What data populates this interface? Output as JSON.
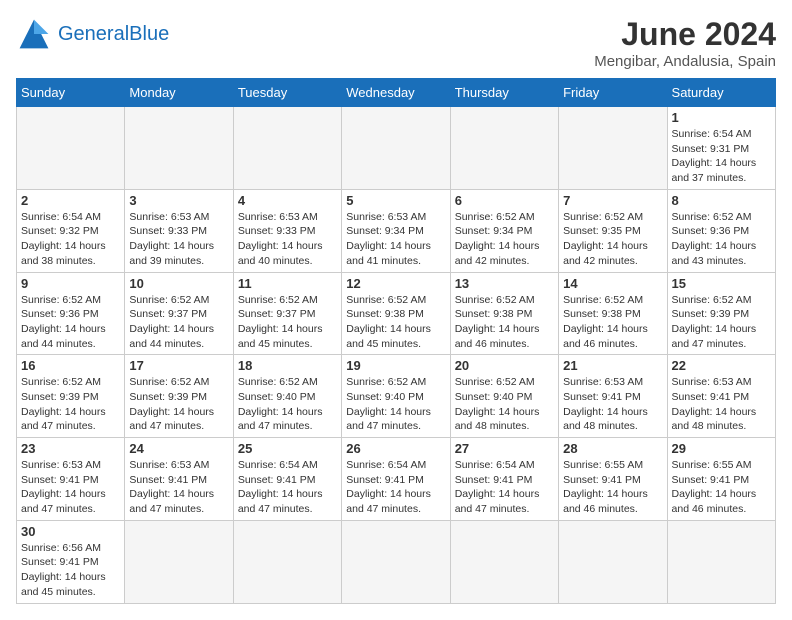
{
  "header": {
    "logo_general": "General",
    "logo_blue": "Blue",
    "month_title": "June 2024",
    "subtitle": "Mengibar, Andalusia, Spain"
  },
  "weekdays": [
    "Sunday",
    "Monday",
    "Tuesday",
    "Wednesday",
    "Thursday",
    "Friday",
    "Saturday"
  ],
  "days": {
    "d1": {
      "num": "1",
      "info": "Sunrise: 6:54 AM\nSunset: 9:31 PM\nDaylight: 14 hours\nand 37 minutes."
    },
    "d2": {
      "num": "2",
      "info": "Sunrise: 6:54 AM\nSunset: 9:32 PM\nDaylight: 14 hours\nand 38 minutes."
    },
    "d3": {
      "num": "3",
      "info": "Sunrise: 6:53 AM\nSunset: 9:33 PM\nDaylight: 14 hours\nand 39 minutes."
    },
    "d4": {
      "num": "4",
      "info": "Sunrise: 6:53 AM\nSunset: 9:33 PM\nDaylight: 14 hours\nand 40 minutes."
    },
    "d5": {
      "num": "5",
      "info": "Sunrise: 6:53 AM\nSunset: 9:34 PM\nDaylight: 14 hours\nand 41 minutes."
    },
    "d6": {
      "num": "6",
      "info": "Sunrise: 6:52 AM\nSunset: 9:34 PM\nDaylight: 14 hours\nand 42 minutes."
    },
    "d7": {
      "num": "7",
      "info": "Sunrise: 6:52 AM\nSunset: 9:35 PM\nDaylight: 14 hours\nand 42 minutes."
    },
    "d8": {
      "num": "8",
      "info": "Sunrise: 6:52 AM\nSunset: 9:36 PM\nDaylight: 14 hours\nand 43 minutes."
    },
    "d9": {
      "num": "9",
      "info": "Sunrise: 6:52 AM\nSunset: 9:36 PM\nDaylight: 14 hours\nand 44 minutes."
    },
    "d10": {
      "num": "10",
      "info": "Sunrise: 6:52 AM\nSunset: 9:37 PM\nDaylight: 14 hours\nand 44 minutes."
    },
    "d11": {
      "num": "11",
      "info": "Sunrise: 6:52 AM\nSunset: 9:37 PM\nDaylight: 14 hours\nand 45 minutes."
    },
    "d12": {
      "num": "12",
      "info": "Sunrise: 6:52 AM\nSunset: 9:38 PM\nDaylight: 14 hours\nand 45 minutes."
    },
    "d13": {
      "num": "13",
      "info": "Sunrise: 6:52 AM\nSunset: 9:38 PM\nDaylight: 14 hours\nand 46 minutes."
    },
    "d14": {
      "num": "14",
      "info": "Sunrise: 6:52 AM\nSunset: 9:38 PM\nDaylight: 14 hours\nand 46 minutes."
    },
    "d15": {
      "num": "15",
      "info": "Sunrise: 6:52 AM\nSunset: 9:39 PM\nDaylight: 14 hours\nand 47 minutes."
    },
    "d16": {
      "num": "16",
      "info": "Sunrise: 6:52 AM\nSunset: 9:39 PM\nDaylight: 14 hours\nand 47 minutes."
    },
    "d17": {
      "num": "17",
      "info": "Sunrise: 6:52 AM\nSunset: 9:39 PM\nDaylight: 14 hours\nand 47 minutes."
    },
    "d18": {
      "num": "18",
      "info": "Sunrise: 6:52 AM\nSunset: 9:40 PM\nDaylight: 14 hours\nand 47 minutes."
    },
    "d19": {
      "num": "19",
      "info": "Sunrise: 6:52 AM\nSunset: 9:40 PM\nDaylight: 14 hours\nand 47 minutes."
    },
    "d20": {
      "num": "20",
      "info": "Sunrise: 6:52 AM\nSunset: 9:40 PM\nDaylight: 14 hours\nand 48 minutes."
    },
    "d21": {
      "num": "21",
      "info": "Sunrise: 6:53 AM\nSunset: 9:41 PM\nDaylight: 14 hours\nand 48 minutes."
    },
    "d22": {
      "num": "22",
      "info": "Sunrise: 6:53 AM\nSunset: 9:41 PM\nDaylight: 14 hours\nand 48 minutes."
    },
    "d23": {
      "num": "23",
      "info": "Sunrise: 6:53 AM\nSunset: 9:41 PM\nDaylight: 14 hours\nand 47 minutes."
    },
    "d24": {
      "num": "24",
      "info": "Sunrise: 6:53 AM\nSunset: 9:41 PM\nDaylight: 14 hours\nand 47 minutes."
    },
    "d25": {
      "num": "25",
      "info": "Sunrise: 6:54 AM\nSunset: 9:41 PM\nDaylight: 14 hours\nand 47 minutes."
    },
    "d26": {
      "num": "26",
      "info": "Sunrise: 6:54 AM\nSunset: 9:41 PM\nDaylight: 14 hours\nand 47 minutes."
    },
    "d27": {
      "num": "27",
      "info": "Sunrise: 6:54 AM\nSunset: 9:41 PM\nDaylight: 14 hours\nand 47 minutes."
    },
    "d28": {
      "num": "28",
      "info": "Sunrise: 6:55 AM\nSunset: 9:41 PM\nDaylight: 14 hours\nand 46 minutes."
    },
    "d29": {
      "num": "29",
      "info": "Sunrise: 6:55 AM\nSunset: 9:41 PM\nDaylight: 14 hours\nand 46 minutes."
    },
    "d30": {
      "num": "30",
      "info": "Sunrise: 6:56 AM\nSunset: 9:41 PM\nDaylight: 14 hours\nand 45 minutes."
    }
  }
}
